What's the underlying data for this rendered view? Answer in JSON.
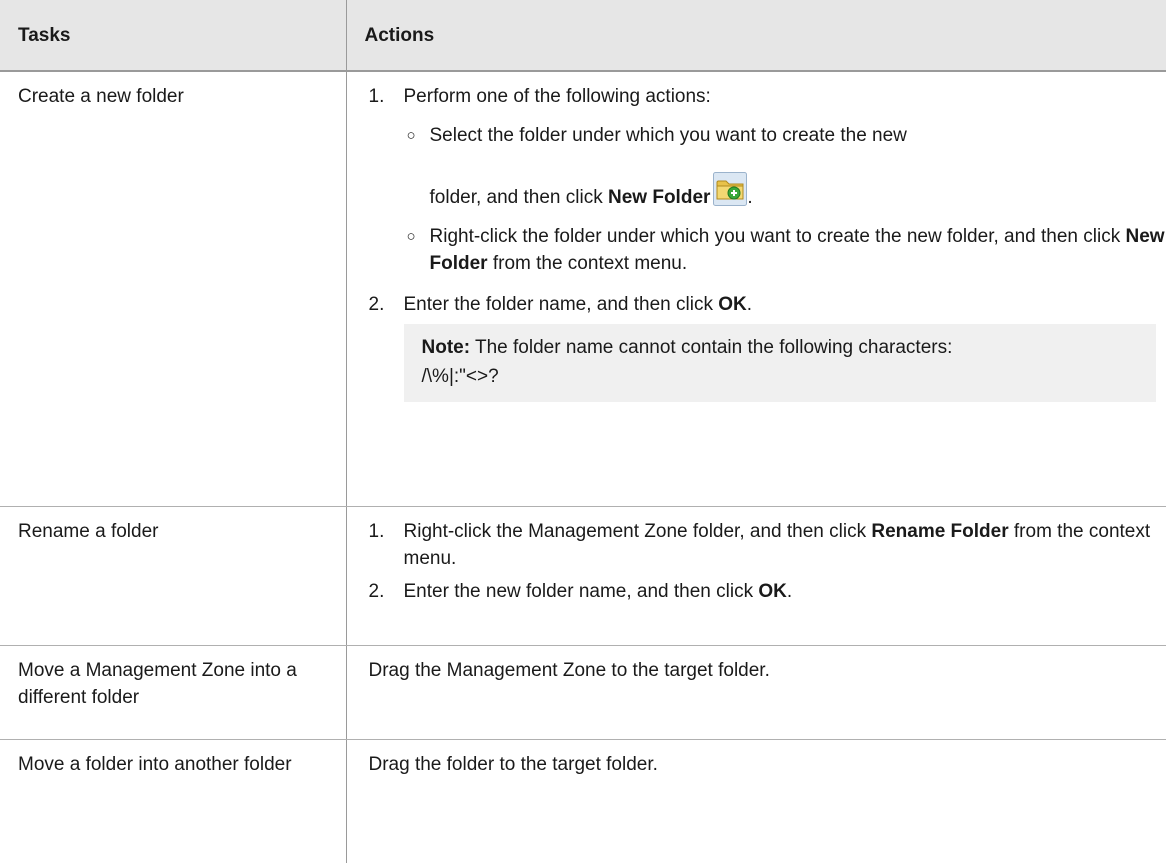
{
  "header": {
    "col1": "Tasks",
    "col2": "Actions"
  },
  "rows": [
    {
      "task": "Create a new folder",
      "step1": {
        "num": "1.",
        "text": "Perform one of the following actions:"
      },
      "sub1": {
        "line1": "Select the folder under which you want to create the new",
        "line2_pre": "folder, and then click ",
        "bold": "New Folder",
        "post": "."
      },
      "sub2": {
        "pre": "Right-click the folder under which you want to create the new folder, and then click ",
        "bold": "New Folder",
        "post": " from the context menu."
      },
      "step2": {
        "num": "2.",
        "pre": "Enter the folder name, and then click ",
        "bold": "OK",
        "post": "."
      },
      "note": {
        "label": "Note:",
        "text": " The folder name cannot contain the following characters:",
        "chars": "/\\%|:\"<>?"
      },
      "icon": "new-folder-icon"
    },
    {
      "task": "Rename a folder",
      "step1": {
        "num": "1.",
        "pre": "Right-click the Management Zone folder, and then click ",
        "bold": "Rename Folder",
        "post": " from the context menu."
      },
      "step2": {
        "num": "2.",
        "pre": "Enter the new folder name, and then click ",
        "bold": "OK",
        "post": "."
      }
    },
    {
      "task": "Move a Management Zone into a different folder",
      "action": "Drag the Management Zone to the target folder."
    },
    {
      "task": "Move a folder into another folder",
      "action": "Drag the folder to the target folder."
    }
  ],
  "bullet_glyph": "○",
  "colors": {
    "header_bg": "#e6e6e6",
    "note_bg": "#f0f0f0",
    "border": "#9a9a9a",
    "icon_folder": "#e8c24a",
    "icon_plus": "#3aa83a"
  }
}
